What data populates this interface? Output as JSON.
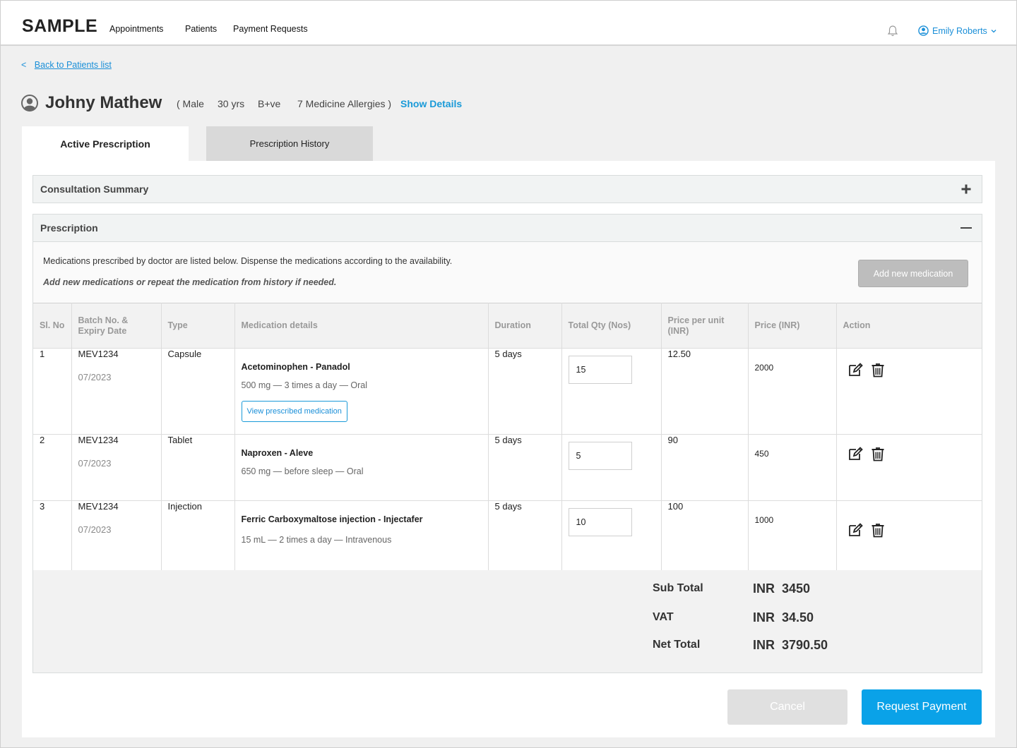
{
  "brand": {
    "logo": "SAMPLE"
  },
  "nav": {
    "appointments": "Appointments",
    "patients": "Patients",
    "payment_requests": "Payment Requests"
  },
  "user": {
    "name": "Emily Roberts",
    "icon": "user-circle-icon"
  },
  "back": {
    "arrow": "<",
    "label": "Back to Patients list"
  },
  "patient": {
    "name": "Johny Mathew",
    "gender": "( Male",
    "age": "30 yrs",
    "blood_group": "B+ve",
    "allergies": "7 Medicine Allergies )",
    "show_details": "Show Details"
  },
  "tabs": {
    "active": "Active Prescription",
    "history": "Prescription History"
  },
  "sections": {
    "consultation": "Consultation Summary",
    "prescription": "Prescription"
  },
  "prescription": {
    "intro": "Medications prescribed by doctor are listed below. Dispense the medications according to the availability.",
    "hint": "Add new medications or repeat the medication from history if needed.",
    "add_button": "Add new medication"
  },
  "table": {
    "headers": {
      "sl_no": "Sl. No",
      "batch": "Batch No. & Expiry Date",
      "type": "Type",
      "details": "Medication details",
      "duration": "Duration",
      "qty": "Total Qty (Nos)",
      "ppu": "Price per unit (INR)",
      "price": "Price (INR)",
      "action": "Action"
    },
    "rows": [
      {
        "sl": "1",
        "batch": "MEV1234",
        "expiry": "07/2023",
        "type": "Capsule",
        "name": "Acetominophen - Panadol",
        "dosage": "500 mg — 3 times a day — Oral",
        "view_label": "View prescribed medication",
        "duration": "5 days",
        "qty": "15",
        "ppu": "12.50",
        "price": "2000"
      },
      {
        "sl": "2",
        "batch": "MEV1234",
        "expiry": "07/2023",
        "type": "Tablet",
        "name": "Naproxen - Aleve",
        "dosage": "650 mg — before sleep — Oral",
        "duration": "5 days",
        "qty": "5",
        "ppu": "90",
        "price": "450"
      },
      {
        "sl": "3",
        "batch": "MEV1234",
        "expiry": "07/2023",
        "type": "Injection",
        "name": "Ferric Carboxymaltose injection - Injectafer",
        "dosage": "15 mL — 2 times a day — Intravenous",
        "duration": "5 days",
        "qty": "10",
        "ppu": "100",
        "price": "1000"
      }
    ]
  },
  "totals": {
    "sub_total_label": "Sub Total",
    "sub_total_cur": "INR",
    "sub_total": "3450",
    "vat_label": "VAT",
    "vat_cur": "INR",
    "vat": "34.50",
    "net_total_label": "Net Total",
    "net_total_cur": "INR",
    "net_total": "3790.50"
  },
  "buttons": {
    "cancel": "Cancel",
    "request_payment": "Request Payment"
  },
  "colors": {
    "accent": "#0aa2e8",
    "link": "#1a8fd8",
    "disabled": "#bdbdbd"
  }
}
